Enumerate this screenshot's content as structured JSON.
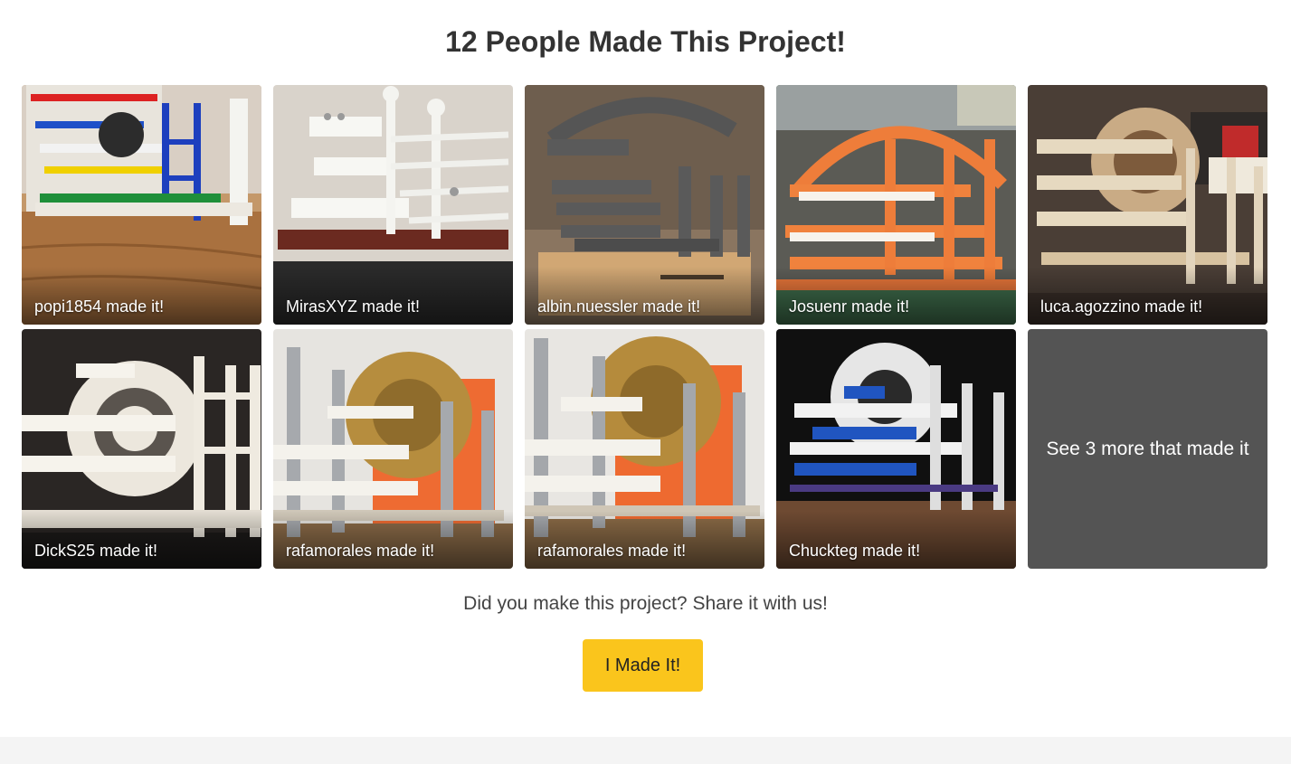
{
  "section": {
    "title": "12 People Made This Project!"
  },
  "made_it": [
    {
      "caption": "popi1854 made it!"
    },
    {
      "caption": "MirasXYZ made it!"
    },
    {
      "caption": "albin.nuessler made it!"
    },
    {
      "caption": "Josuenr made it!"
    },
    {
      "caption": "luca.agozzino made it!"
    },
    {
      "caption": "DickS25 made it!"
    },
    {
      "caption": "rafamorales made it!"
    },
    {
      "caption": "rafamorales made it!"
    },
    {
      "caption": "Chuckteg made it!"
    }
  ],
  "see_more": "See 3 more that made it",
  "prompt": "Did you make this project? Share it with us!",
  "button": {
    "label": "I Made It!"
  },
  "colors": {
    "button_bg": "#fac51c",
    "see_more_bg": "#545454",
    "footer_band": "#f4f4f4"
  }
}
